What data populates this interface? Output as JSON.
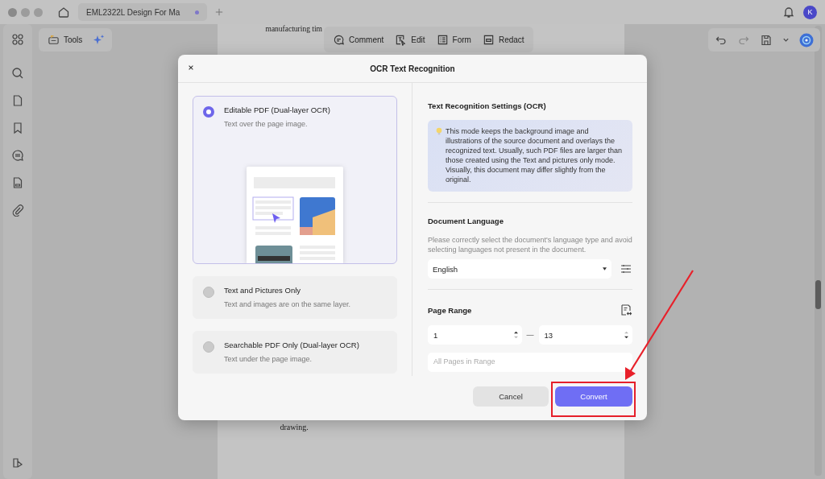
{
  "window": {
    "tab_title": "EML2322L Design For Ma",
    "avatar": "K"
  },
  "toolbar": {
    "tools_label": "Tools",
    "edit_tools": [
      {
        "label": "Comment",
        "kind": "comment"
      },
      {
        "label": "Edit",
        "kind": "edit"
      },
      {
        "label": "Form",
        "kind": "form"
      },
      {
        "label": "Redact",
        "kind": "redact"
      }
    ]
  },
  "document": {
    "top_text": "manufacturing tim",
    "bottom_text": "drawing."
  },
  "dialog": {
    "title": "OCR Text Recognition",
    "modes": [
      {
        "title": "Editable PDF (Dual-layer OCR)",
        "description": "Text over the page image.",
        "selected": true,
        "kind": "illustrated"
      },
      {
        "title": "Text and Pictures Only",
        "description": "Text and images are on the same layer.",
        "selected": false,
        "kind": "plain"
      },
      {
        "title": "Searchable PDF Only (Dual-layer OCR)",
        "description": "Text under the page image.",
        "selected": false,
        "kind": "plain"
      }
    ],
    "settings_title": "Text Recognition Settings (OCR)",
    "info": "This mode keeps the background image and illustrations of the source document and overlays the recognized text. Usually, such PDF files are larger than those created using the Text and pictures only mode. Visually, this document may differ slightly from the original.",
    "language_title": "Document Language",
    "language_hint": "Please correctly select the document's language type and avoid selecting languages not present in the document.",
    "language": "English",
    "page_range_title": "Page Range",
    "range_from": "1",
    "range_separator": "—",
    "range_to": "13",
    "subset": "All Pages in Range",
    "buttons": [
      {
        "label": "Cancel",
        "kind": "secondary"
      },
      {
        "label": "Convert",
        "kind": "primary"
      }
    ]
  }
}
